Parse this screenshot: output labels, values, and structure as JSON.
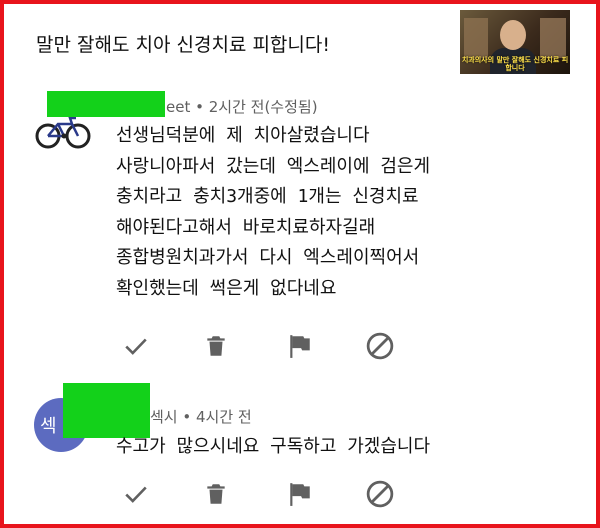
{
  "video": {
    "title": "말만 잘해도  치아 신경치료 피합니다!",
    "thumbnail_caption": "치과의사의 말만 잘해도 신경치료 피합니다"
  },
  "comments": [
    {
      "author_partial": "eet",
      "meta": " • 2시간 전(수정됨)",
      "avatar_icon": "bicycle-avatar-icon",
      "text": "선생님덕분에 제 치아살렸습니다\n사랑니아파서 갔는데 엑스레이에 검은게\n충치라고 충치3개중에 1개는 신경치료\n해야된다고해서 바로치료하자길래\n종합병원치과가서 다시 엑스레이찍어서\n확인했는데 썩은게 없다네요",
      "actions": [
        "check-icon",
        "trash-icon",
        "flag-icon",
        "block-icon"
      ]
    },
    {
      "author_partial": "섹시",
      "meta": " • 4시간 전",
      "avatar_letter": "섹",
      "text": "수고가 많으시네요 구독하고 가겠습니다",
      "actions": [
        "check-icon",
        "trash-icon",
        "flag-icon",
        "block-icon"
      ]
    }
  ],
  "colors": {
    "frame": "#e8141c",
    "redaction": "#13d11a",
    "avatar": "#5c6bc0",
    "icon": "#606060"
  }
}
